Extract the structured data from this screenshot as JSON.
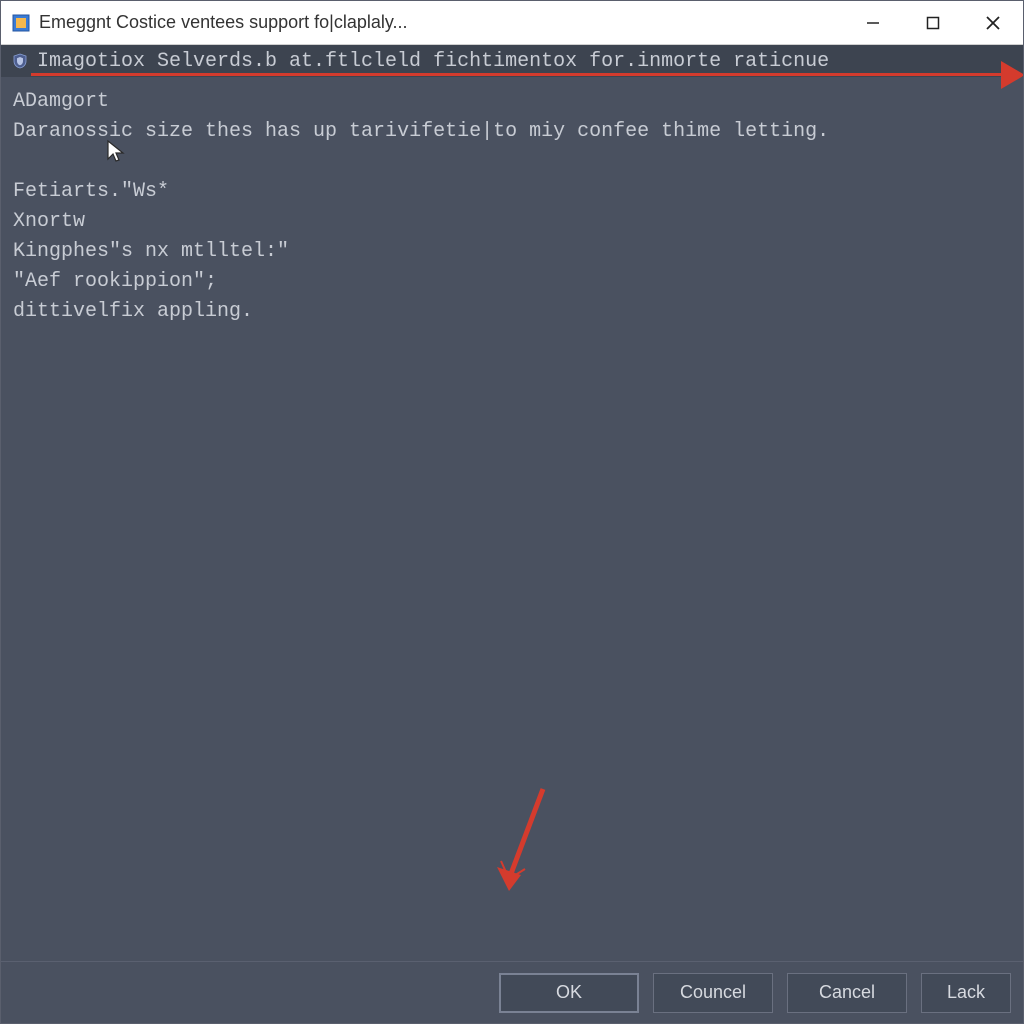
{
  "titlebar": {
    "title": "Emeggnt Costice ventees support fo|claplaly..."
  },
  "infobar": {
    "text": "Imagotiox Selverds.b at.ftlcleld fichtimentox for.inmorte raticnue"
  },
  "body": {
    "lines": "ADamgort\nDaranossic size thes has up tarivifetie|to miy confee thime letting.\n\nFetiarts.\"Ws*\nXnortw\nKingphes\"s nx mtlltel:\"\n\"Aef rookippion\";\ndittivelfix appling."
  },
  "buttons": {
    "ok": "OK",
    "councel": "Councel",
    "cancel": "Cancel",
    "lack": "Lack"
  }
}
